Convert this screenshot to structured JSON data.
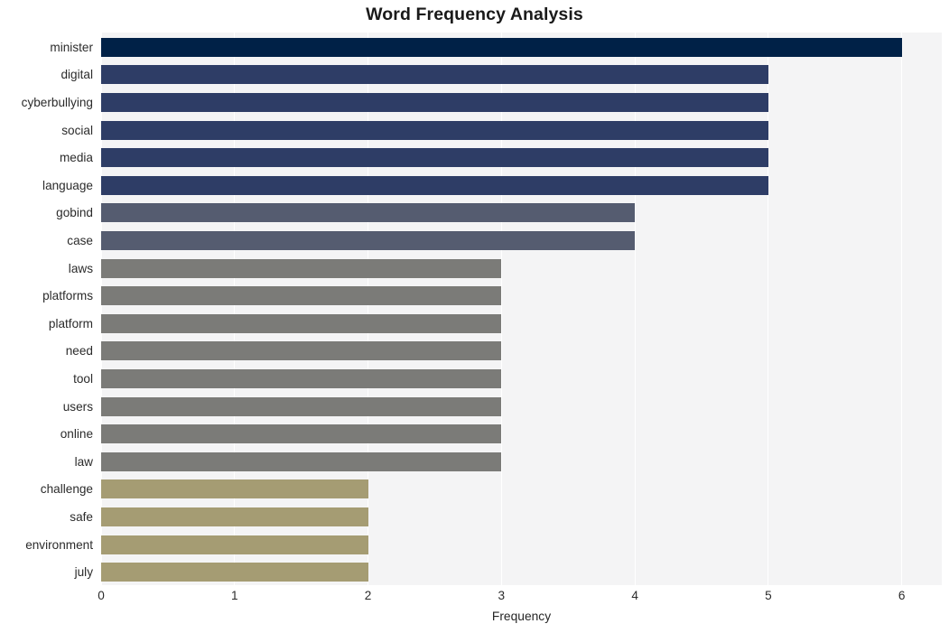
{
  "chart_data": {
    "type": "bar",
    "orientation": "horizontal",
    "title": "Word Frequency Analysis",
    "xlabel": "Frequency",
    "ylabel": "",
    "xlim": [
      0,
      6.3
    ],
    "xticks": [
      0,
      1,
      2,
      3,
      4,
      5,
      6
    ],
    "xticklabels": [
      "0",
      "1",
      "2",
      "3",
      "4",
      "5",
      "6"
    ],
    "grid": "vertical-white-on-light-gray",
    "legend": "none",
    "categories": [
      "minister",
      "digital",
      "cyberbullying",
      "social",
      "media",
      "language",
      "gobind",
      "case",
      "laws",
      "platforms",
      "platform",
      "need",
      "tool",
      "users",
      "online",
      "law",
      "challenge",
      "safe",
      "environment",
      "july"
    ],
    "values": [
      6,
      5,
      5,
      5,
      5,
      5,
      4,
      4,
      3,
      3,
      3,
      3,
      3,
      3,
      3,
      3,
      2,
      2,
      2,
      2
    ],
    "bar_colors": [
      "#002147",
      "#2e3d66",
      "#2e3d66",
      "#2e3d66",
      "#2e3d66",
      "#2e3d66",
      "#555c70",
      "#555c70",
      "#7b7b78",
      "#7b7b78",
      "#7b7b78",
      "#7b7b78",
      "#7b7b78",
      "#7b7b78",
      "#7b7b78",
      "#7b7b78",
      "#a59c73",
      "#a59c73",
      "#a59c73",
      "#a59c73"
    ]
  },
  "style": {
    "figure_background": "#ffffff",
    "axes_background": "#f4f4f5",
    "gridline_color": "#ffffff",
    "title_color": "#1a1a1a",
    "tick_color": "#2b2b2b"
  }
}
